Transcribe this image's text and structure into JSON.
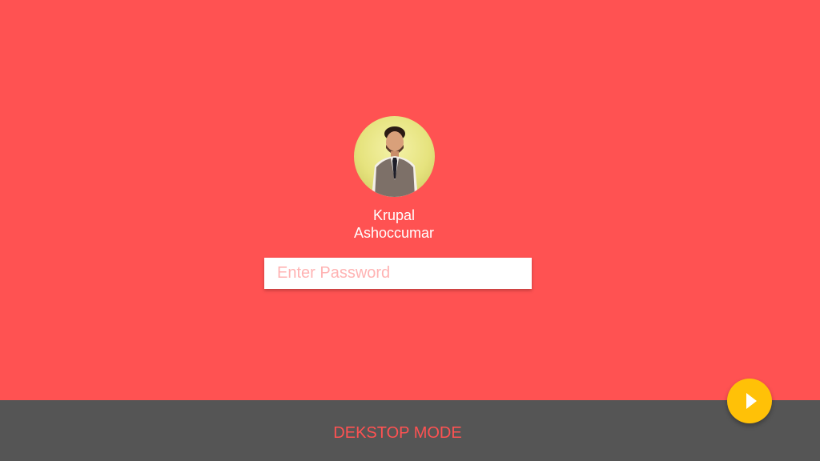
{
  "user": {
    "first_name": "Krupal",
    "last_name": "Ashoccumar",
    "avatar": "user-photo"
  },
  "password": {
    "placeholder": "Enter Password",
    "value": ""
  },
  "footer": {
    "mode_label": "DEKSTOP MODE"
  },
  "submit": {
    "icon": "play-arrow-icon"
  },
  "colors": {
    "background": "#ff5252",
    "footer_bar": "#555555",
    "accent_button": "#ffc107",
    "mode_text": "#ff5252",
    "placeholder_text": "#ffb3b3"
  }
}
